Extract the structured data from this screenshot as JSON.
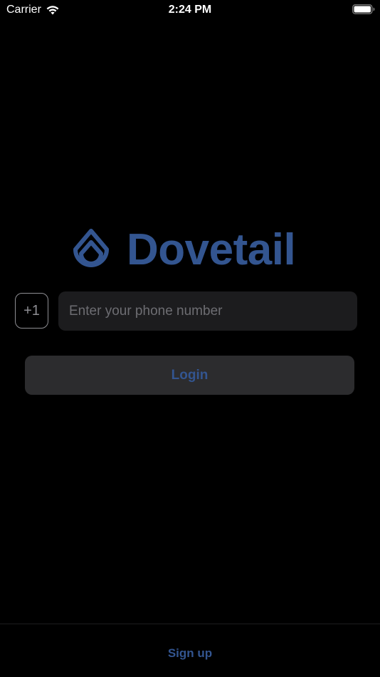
{
  "status_bar": {
    "carrier": "Carrier",
    "time": "2:24 PM",
    "wifi_icon": "wifi-icon",
    "battery_icon": "battery-icon"
  },
  "brand": {
    "name": "Dovetail",
    "icon": "dovetail-logo-icon",
    "color": "#335590"
  },
  "login_form": {
    "country_code": "+1",
    "phone_value": "",
    "phone_placeholder": "Enter your phone number",
    "login_label": "Login"
  },
  "footer": {
    "signup_label": "Sign up"
  },
  "colors": {
    "background": "#000000",
    "field_background": "#1c1c1e",
    "button_background": "#2c2c2e",
    "accent": "#335590",
    "placeholder": "#6d6d72"
  }
}
